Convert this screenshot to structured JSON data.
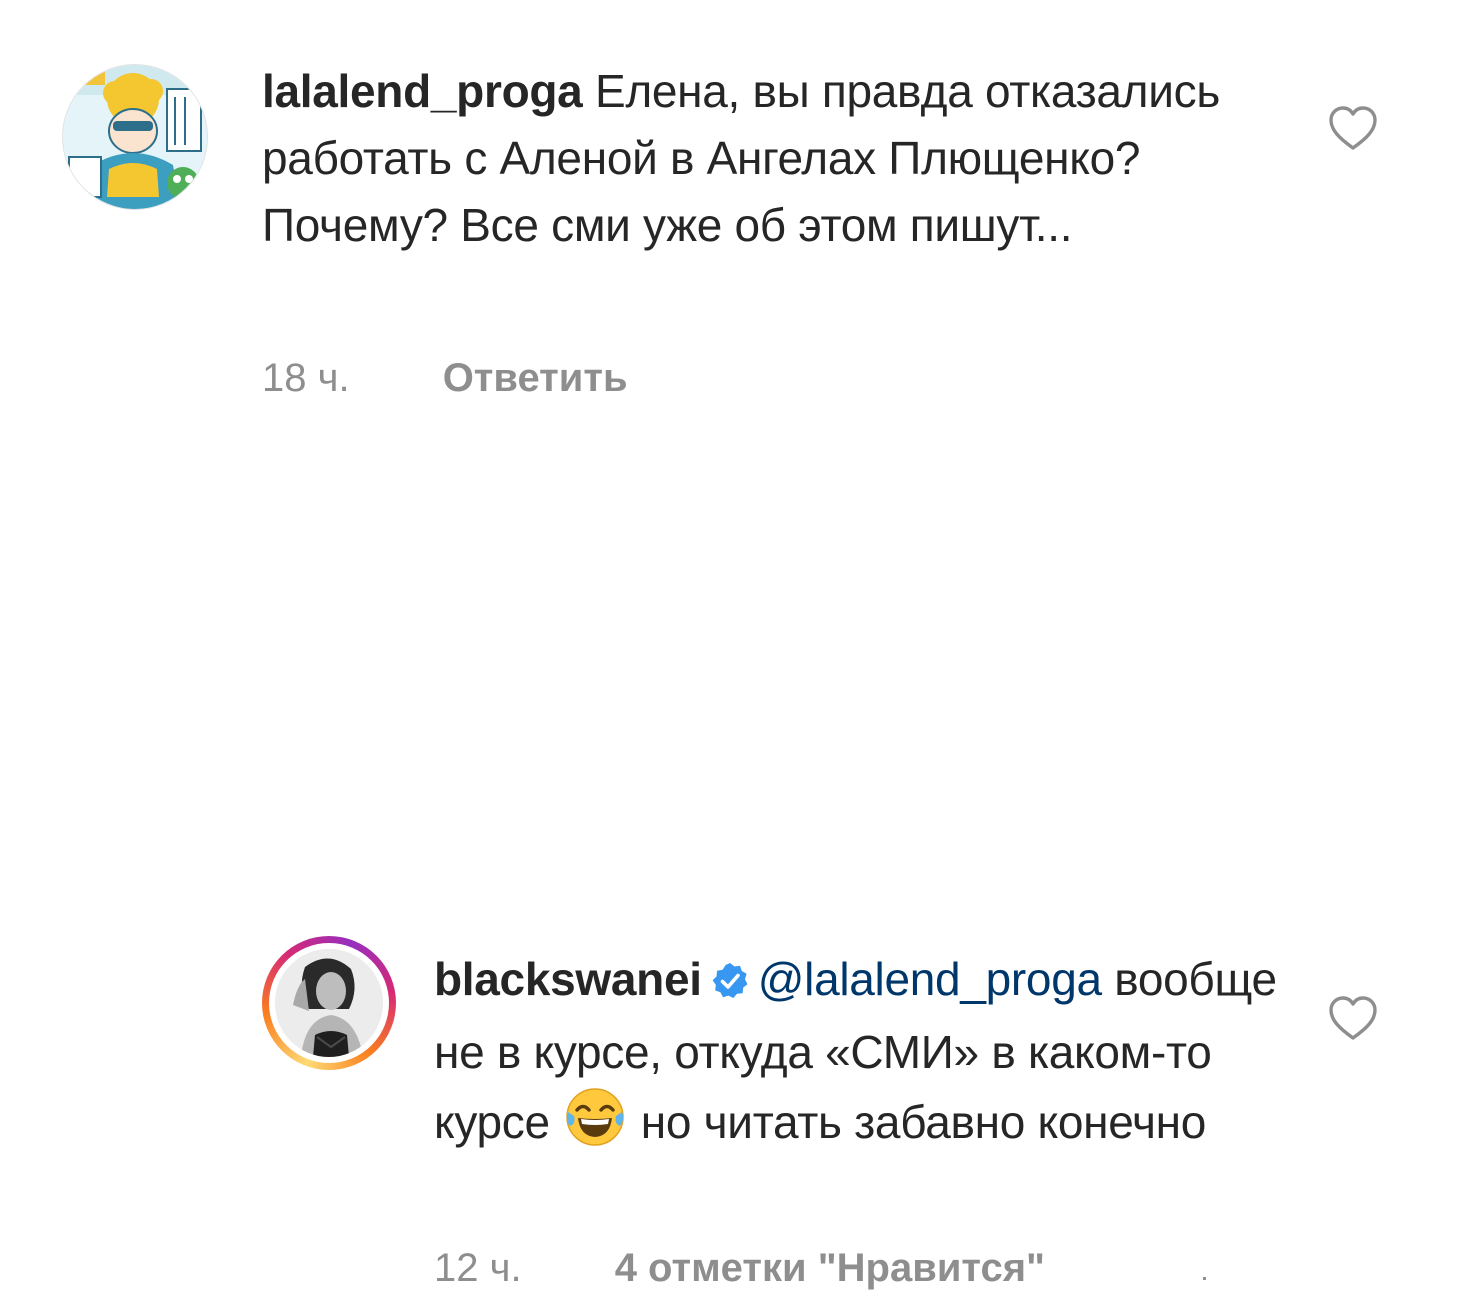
{
  "comments": [
    {
      "username": "lalalend_proga",
      "text": "Елена, вы правда отказались работать с Аленой в Ангелах Плющенко? Почему? Все сми уже об этом пишут...",
      "time": "18 ч.",
      "action": "Ответить",
      "avatar_icon": "anime-character-avatar",
      "like_icon": "heart-outline-icon",
      "verified": false
    },
    {
      "username": "blackswanei",
      "mention": "@lalalend_proga",
      "text_before_emoji": "вообще не в курсе, откуда «СМИ» в каком-то курсе",
      "emoji": "face-with-tears-of-joy",
      "text_after_emoji": "но читать забавно конечно",
      "time": "12 ч.",
      "likes_label": "4 отметки \"Нравится\"",
      "avatar_icon": "portrait-photo-avatar",
      "like_icon": "heart-outline-icon",
      "verified": true,
      "has_story_ring": true
    }
  ],
  "colors": {
    "text": "#262626",
    "secondary": "#8e8e8e",
    "mention": "#00376b",
    "verified_badge": "#3897f0"
  }
}
